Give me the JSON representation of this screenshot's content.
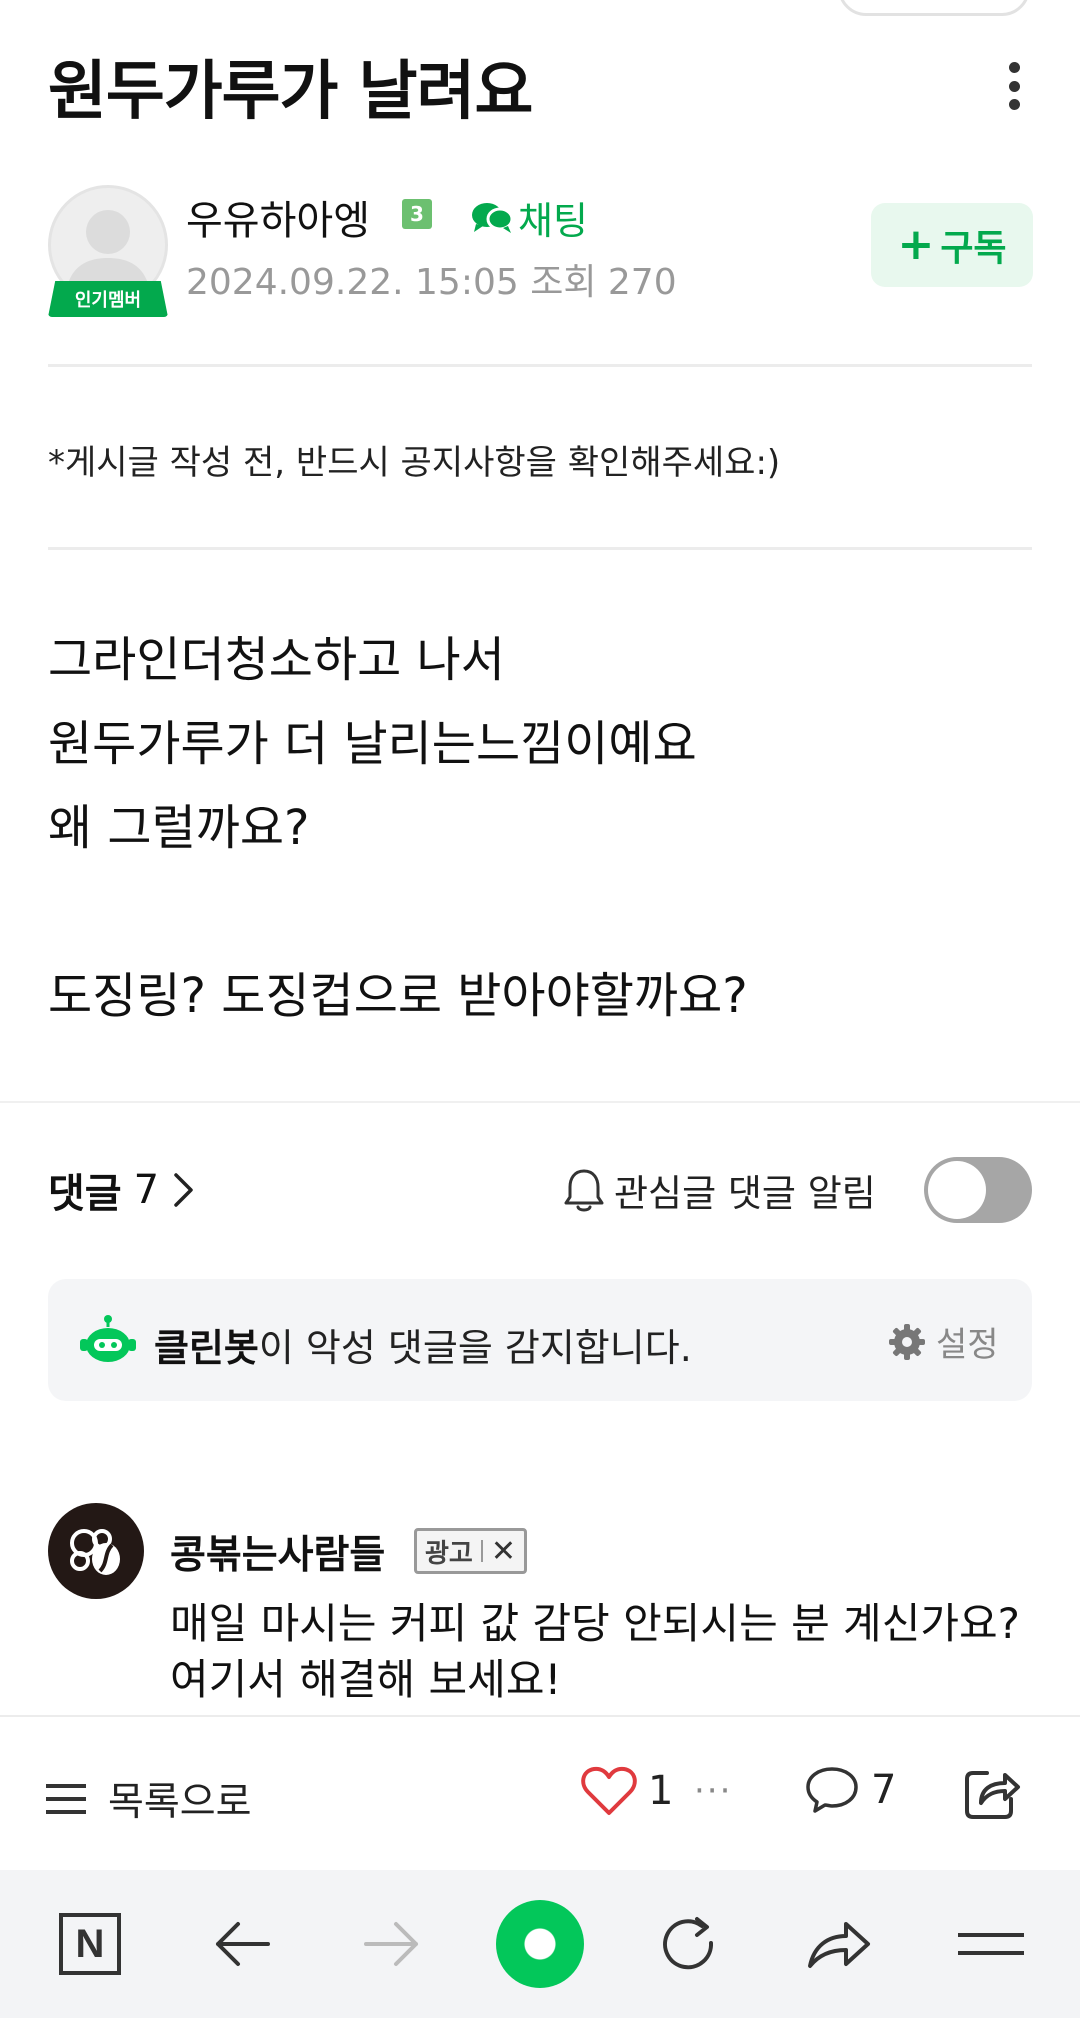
{
  "post": {
    "title": "원두가루가 날려요",
    "author": "우유하아엥",
    "level": "3",
    "member_badge": "인기멤버",
    "chat_label": "채팅",
    "meta": "2024.09.22. 15:05  조회 270",
    "subscribe_label": "구독",
    "notice": "*게시글 작성 전, 반드시 공지사항을 확인해주세요:)",
    "body_lines": [
      "그라인더청소하고 나서",
      "원두가루가 더 날리는느낌이예요",
      "왜 그럴까요?",
      "",
      "도징링? 도징컵으로 받아야할까요?"
    ]
  },
  "comments": {
    "label": "댓글",
    "count": "7",
    "watch_alert_label": "관심글 댓글 알림",
    "watch_alert_on": false
  },
  "cleanbot": {
    "name": "클린봇",
    "message": "이 악성 댓글을 감지합니다.",
    "settings_label": "설정"
  },
  "ad": {
    "name": "콩볶는사람들",
    "tag": "광고",
    "close": "✕",
    "text": "매일 마시는 커피 값 감당 안되시는 분 계신가요? 여기서 해결해 보세요!"
  },
  "action_bar": {
    "to_list_label": "목록으로",
    "like_count": "1",
    "more": "···",
    "comment_count": "7"
  },
  "browser": {
    "home_label": "N"
  },
  "colors": {
    "accent": "#03a94d",
    "subscribe_bg": "#e8f8ee",
    "like_heart": "#e03a3e",
    "toggle_off": "#a6a6a6"
  }
}
